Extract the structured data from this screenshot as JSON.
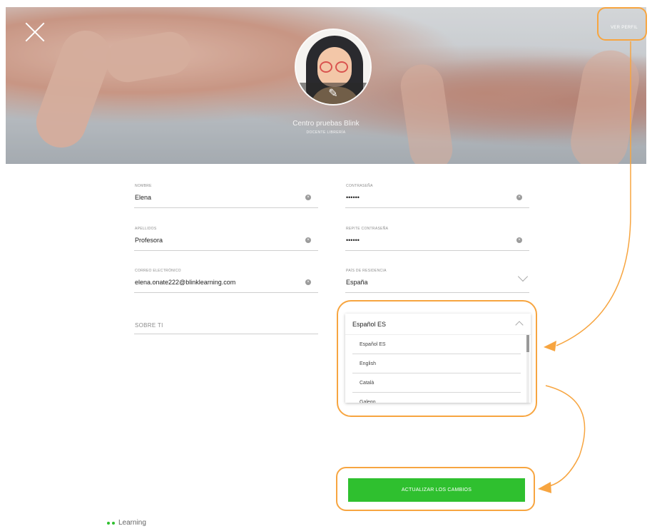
{
  "header": {
    "ver_perfil": "VER PERFIL",
    "centro_name": "Centro pruebas Blink",
    "role": "DOCENTE LIBRERÍA"
  },
  "form": {
    "nombre": {
      "label": "NOMBRE",
      "value": "Elena"
    },
    "contrasena": {
      "label": "CONTRASEÑA",
      "value": "••••••"
    },
    "apellidos": {
      "label": "APELLIDOS",
      "value": "Profesora"
    },
    "repite": {
      "label": "REPITE CONTRASEÑA",
      "value": "••••••"
    },
    "correo": {
      "label": "CORREO ELECTRÓNICO",
      "value": "elena.onate222@blinklearning.com"
    },
    "pais": {
      "label": "PAÍS DE RESIDENCIA",
      "value": "España"
    },
    "sobre": {
      "label": "SOBRE TI"
    }
  },
  "language": {
    "selected": "Español ES",
    "options": [
      "Español ES",
      "English",
      "Català",
      "Galego"
    ]
  },
  "submit_label": "ACTUALIZAR LOS CAMBIOS",
  "brand": {
    "label": "Learning"
  },
  "colors": {
    "accent": "#2fc02f",
    "highlight": "#f7a540"
  }
}
